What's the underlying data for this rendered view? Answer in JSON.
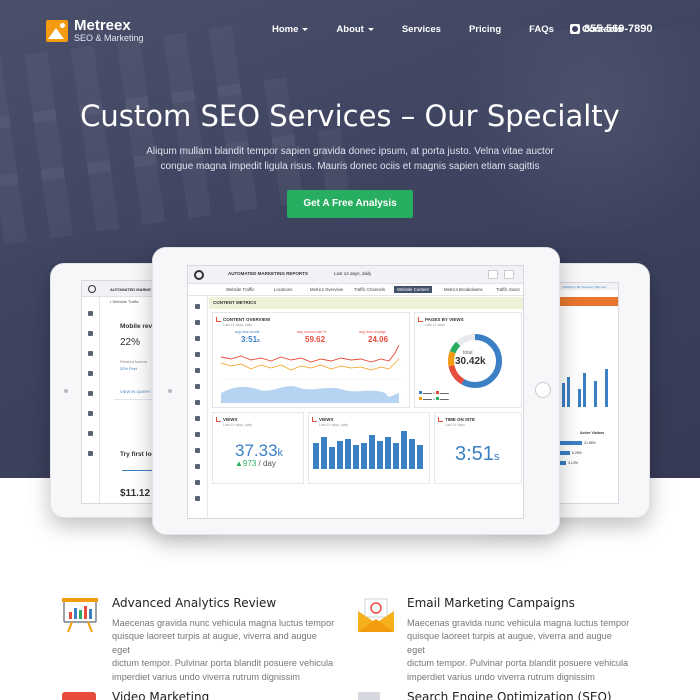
{
  "nav": {
    "brand": "Metreex",
    "tagline": "SEO & Marketing",
    "items": [
      {
        "label": "Home",
        "dropdown": true
      },
      {
        "label": "About",
        "dropdown": true
      },
      {
        "label": "Services",
        "dropdown": false
      },
      {
        "label": "Pricing",
        "dropdown": false
      },
      {
        "label": "FAQs",
        "dropdown": false
      },
      {
        "label": "Contacts",
        "dropdown": false
      }
    ],
    "phone": "855-569-7890"
  },
  "hero": {
    "title": "Custom SEO Services – Our Specialty",
    "subtitle_line1": "Aliqum mullam blandit tempor sapien gravida donec ipsum, at porta justo. Velna vitae auctor",
    "subtitle_line2": "congue magna impedit ligula risus. Mauris donec ociis et magnis sapien etiam sagittis",
    "cta": "Get A Free Analysis"
  },
  "dashboard": {
    "report_title": "AUTOMATED MARKETING REPORTS",
    "date_range": "Last 14 days, daily",
    "tabs": [
      "Website Traffic",
      "Locations",
      "Metrics Overview",
      "Traffic Channels",
      "Website Content",
      "Metrics Breakdowns",
      "Traffic Sourc"
    ],
    "active_tab": "Website Content",
    "section": "CONTENT METRICS",
    "overview": {
      "title": "CONTENT OVERVIEW",
      "sub": "Last 14 days, daily",
      "metrics": [
        {
          "label": "avg. time on site",
          "value": "3:51",
          "unit": "s"
        },
        {
          "label": "avg. bounce rate %",
          "value": "59.62",
          "unit": ""
        },
        {
          "label": "avg. time on page",
          "value": "24.06",
          "unit": ""
        }
      ]
    },
    "pages": {
      "title": "PAGES BY VIEWS",
      "sub": "Last 14 days",
      "total_label": "total",
      "total": "30.42k"
    },
    "views1": {
      "title": "VIEWS",
      "sub": "Last 14 days, daily",
      "value": "37.33",
      "suffix": "k",
      "delta": "▲973",
      "per": "/ day"
    },
    "views2": {
      "title": "VIEWS",
      "sub": "Last 14 days, daily"
    },
    "time_on_site": {
      "title": "TIME ON SITE",
      "sub": "Last 14 days",
      "value": "3:51",
      "unit": "s"
    }
  },
  "left_screen": {
    "heading1": "Mobile revenue",
    "pct": "22%",
    "related": "Related factors",
    "stat": "32% First",
    "heading2": "Try first look",
    "price": "$11.12",
    "link": "VIEW IN QUERY E"
  },
  "right_screen": {
    "header": "Active Visitors",
    "percents": [
      "21.88%",
      "6.25%",
      "3.13%"
    ]
  },
  "features": [
    {
      "title": "Advanced Analytics Review",
      "icon": "analytics-board-icon",
      "lines": [
        "Maecenas gravida nunc vehicula magna luctus tempor",
        "quisque laoreet turpis at augue, viverra and augue eget",
        "dictum tempor. Pulvinar porta blandit posuere vehicula",
        "imperdiet varius undo viverra rutrum dignissim"
      ]
    },
    {
      "title": "Email Marketing Campaigns",
      "icon": "email-envelope-icon",
      "lines": [
        "Maecenas gravida nunc vehicula magna luctus tempor",
        "quisque laoreet turpis at augue, viverra and augue eget",
        "dictum tempor. Pulvinar porta blandit posuere vehicula",
        "imperdiet varius undo viverra rutrum dignissim"
      ]
    },
    {
      "title": "Video Marketing",
      "icon": "video-icon",
      "lines": []
    },
    {
      "title": "Search Engine Optimization (SEO)",
      "icon": "seo-document-icon",
      "lines": []
    }
  ],
  "colors": {
    "hero_bg": "#3e4360",
    "cta": "#27ae60",
    "accent_blue": "#3b7fc4",
    "accent_red": "#e74c3c",
    "brand_orange": "#f39c12"
  }
}
